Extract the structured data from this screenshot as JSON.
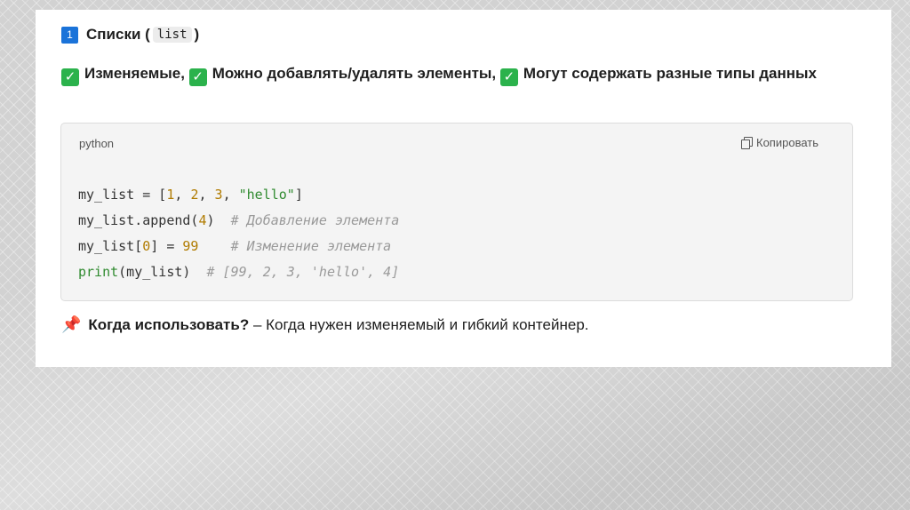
{
  "heading": {
    "number_icon": "1",
    "title": "Списки (",
    "code": "list",
    "close": ")"
  },
  "features": [
    "Изменяемые,",
    "Можно добавлять/удалять элементы,",
    "Могут содержать разные типы данных"
  ],
  "code_block": {
    "language": "python",
    "copy_label": "Копировать",
    "lines": [
      {
        "parts": [
          {
            "t": "my_list = [",
            "c": ""
          },
          {
            "t": "1",
            "c": "num"
          },
          {
            "t": ", ",
            "c": ""
          },
          {
            "t": "2",
            "c": "num"
          },
          {
            "t": ", ",
            "c": ""
          },
          {
            "t": "3",
            "c": "num"
          },
          {
            "t": ", ",
            "c": ""
          },
          {
            "t": "\"hello\"",
            "c": "str"
          },
          {
            "t": "]",
            "c": ""
          }
        ]
      },
      {
        "parts": [
          {
            "t": "my_list.append(",
            "c": ""
          },
          {
            "t": "4",
            "c": "num"
          },
          {
            "t": ")  ",
            "c": ""
          },
          {
            "t": "# Добавление элемента",
            "c": "com"
          }
        ]
      },
      {
        "parts": [
          {
            "t": "my_list[",
            "c": ""
          },
          {
            "t": "0",
            "c": "num"
          },
          {
            "t": "] = ",
            "c": ""
          },
          {
            "t": "99",
            "c": "num"
          },
          {
            "t": "    ",
            "c": ""
          },
          {
            "t": "# Изменение элемента",
            "c": "com"
          }
        ]
      },
      {
        "parts": [
          {
            "t": "print",
            "c": "fn"
          },
          {
            "t": "(my_list)  ",
            "c": ""
          },
          {
            "t": "# [99, 2, 3, 'hello', 4]",
            "c": "com"
          }
        ]
      }
    ]
  },
  "when": {
    "label": "Когда использовать?",
    "dash": " – ",
    "text": "Когда нужен изменяемый и гибкий контейнер."
  },
  "icons": {
    "number": "keycap-1-icon",
    "check": "check-mark-icon",
    "pin": "pushpin-icon",
    "copy": "copy-icon"
  },
  "colors": {
    "check": "#2bb24c",
    "number": "#1a73d9",
    "string": "#2f8a2f",
    "number_literal": "#b07b00",
    "comment": "#9a9a9a"
  }
}
